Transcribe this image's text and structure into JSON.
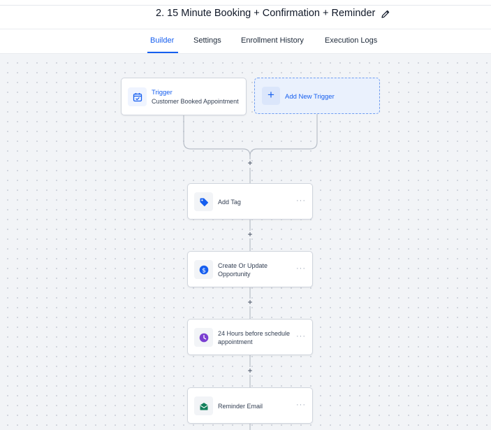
{
  "header": {
    "title": "2. 15 Minute Booking + Confirmation + Reminder",
    "edit_icon": "pencil-icon"
  },
  "tabs": [
    {
      "label": "Builder",
      "active": true
    },
    {
      "label": "Settings",
      "active": false
    },
    {
      "label": "Enrollment History",
      "active": false
    },
    {
      "label": "Execution Logs",
      "active": false
    }
  ],
  "colors": {
    "accent": "#155eef",
    "canvas_bg": "#f2f4f7",
    "tag_icon": "#155eef",
    "opportunity_icon": "#155eef",
    "wait_icon": "#7a3fd1",
    "email_icon": "#12805c"
  },
  "trigger": {
    "title": "Trigger",
    "subtitle": "Customer Booked Appointment",
    "icon": "calendar-check-icon"
  },
  "add_trigger": {
    "label": "Add New Trigger",
    "icon": "plus-icon"
  },
  "actions": [
    {
      "label": "Add Tag",
      "icon": "tag-icon"
    },
    {
      "label": "Create Or Update Opportunity",
      "icon": "dollar-circle-icon"
    },
    {
      "label": "24 Hours before schedule appointment",
      "icon": "clock-icon"
    },
    {
      "label": "Reminder Email",
      "icon": "email-icon"
    }
  ],
  "menu_glyph": "···",
  "add_step_glyph": "+"
}
